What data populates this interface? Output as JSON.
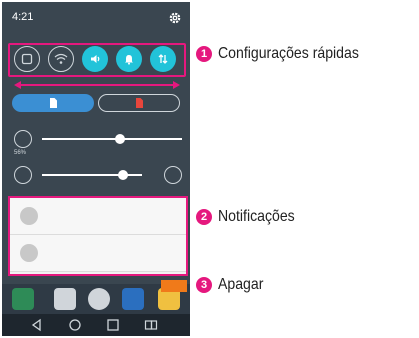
{
  "status_bar": {
    "time": "4:21",
    "settings_icon": "gear-icon"
  },
  "quick_settings": {
    "buttons": [
      {
        "icon": "screen-mirror-icon",
        "active": false
      },
      {
        "icon": "wifi-icon",
        "active": false
      },
      {
        "icon": "sound-icon",
        "active": true
      },
      {
        "icon": "notification-bell-icon",
        "active": true
      },
      {
        "icon": "data-transfer-icon",
        "active": true
      }
    ],
    "swipe_indicator": "double-arrow-icon"
  },
  "brightness": {
    "percent_label": "56%",
    "level": 0.56
  },
  "volume": {
    "level": 0.58
  },
  "notifications": {
    "count": 2
  },
  "callouts": [
    {
      "number": "1",
      "label": "Configurações rápidas"
    },
    {
      "number": "2",
      "label": "Notificações"
    },
    {
      "number": "3",
      "label": "Apagar"
    }
  ],
  "colors": {
    "highlight": "#e5187e",
    "active_toggle": "#22c3d9",
    "clear_button": "#f07a1a",
    "panel_bg": "#3a4650"
  }
}
